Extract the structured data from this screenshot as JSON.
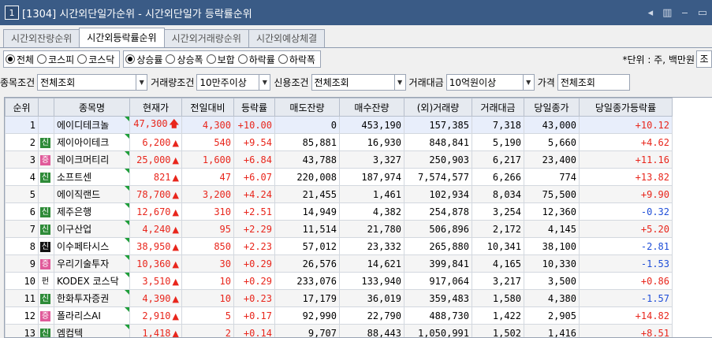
{
  "window": {
    "number": "1",
    "title": "[1304] 시간외단일가순위 - 시간외단일가 등락률순위",
    "controls": [
      "◂",
      "▥",
      "‒",
      "▭"
    ]
  },
  "tabs": [
    {
      "label": "시간외잔량순위",
      "active": false
    },
    {
      "label": "시간외등락률순위",
      "active": true
    },
    {
      "label": "시간외거래량순위",
      "active": false
    },
    {
      "label": "시간외예상체결",
      "active": false
    }
  ],
  "market_radios": [
    {
      "label": "전체",
      "selected": true
    },
    {
      "label": "코스피",
      "selected": false
    },
    {
      "label": "코스닥",
      "selected": false
    }
  ],
  "sort_radios": [
    {
      "label": "상승률",
      "selected": true
    },
    {
      "label": "상승폭",
      "selected": false
    },
    {
      "label": "보합",
      "selected": false
    },
    {
      "label": "하락률",
      "selected": false
    },
    {
      "label": "하락폭",
      "selected": false
    }
  ],
  "unit_text": "*단위 : 주, 백만원",
  "unit_button": "조",
  "filters": [
    {
      "label": "종목조건",
      "value": "전체조회"
    },
    {
      "label": "거래량조건",
      "value": "10만주이상"
    },
    {
      "label": "신용조건",
      "value": "전체조회"
    },
    {
      "label": "거래대금",
      "value": "10억원이상"
    },
    {
      "label": "가격",
      "value": "전체조회"
    }
  ],
  "columns": [
    "순위",
    "",
    "종목명",
    "현재가",
    "전일대비",
    "등락률",
    "매도잔량",
    "매수잔량",
    "(외)거래량",
    "거래대금",
    "당일종가",
    "당일종가등락률"
  ],
  "colors": {
    "up": "#e8261c",
    "down": "#1f4ed8",
    "title_bar": "#3a5b86",
    "badge_green": "#2e8b38",
    "badge_pink": "#e05a9a"
  },
  "rows": [
    {
      "rank": "1",
      "badge": "",
      "badge_color": "",
      "name": "에이디테크놀",
      "price": "47,300",
      "arrow": "up-bold",
      "change": "4,300",
      "rate": "+10.00",
      "ask": "0",
      "bid": "453,190",
      "volume": "157,385",
      "amount": "7,318",
      "close": "43,000",
      "close_rate": "+10.12",
      "close_dir": "up"
    },
    {
      "rank": "2",
      "badge": "신",
      "badge_color": "green",
      "name": "제이아이테크",
      "price": "6,200",
      "arrow": "up",
      "change": "540",
      "rate": "+9.54",
      "ask": "85,881",
      "bid": "16,930",
      "volume": "848,841",
      "amount": "5,190",
      "close": "5,660",
      "close_rate": "+4.62",
      "close_dir": "up"
    },
    {
      "rank": "3",
      "badge": "증",
      "badge_color": "pink",
      "name": "레이크머티리",
      "price": "25,000",
      "arrow": "up",
      "change": "1,600",
      "rate": "+6.84",
      "ask": "43,788",
      "bid": "3,327",
      "volume": "250,903",
      "amount": "6,217",
      "close": "23,400",
      "close_rate": "+11.16",
      "close_dir": "up"
    },
    {
      "rank": "4",
      "badge": "신",
      "badge_color": "green",
      "name": "소프트센",
      "price": "821",
      "arrow": "up",
      "change": "47",
      "rate": "+6.07",
      "ask": "220,008",
      "bid": "187,974",
      "volume": "7,574,577",
      "amount": "6,266",
      "close": "774",
      "close_rate": "+13.82",
      "close_dir": "up"
    },
    {
      "rank": "5",
      "badge": "",
      "badge_color": "",
      "name": "에이직랜드",
      "price": "78,700",
      "arrow": "up",
      "change": "3,200",
      "rate": "+4.24",
      "ask": "21,455",
      "bid": "1,461",
      "volume": "102,934",
      "amount": "8,034",
      "close": "75,500",
      "close_rate": "+9.90",
      "close_dir": "up"
    },
    {
      "rank": "6",
      "badge": "신",
      "badge_color": "green",
      "name": "제주은행",
      "price": "12,670",
      "arrow": "up",
      "change": "310",
      "rate": "+2.51",
      "ask": "14,949",
      "bid": "4,382",
      "volume": "254,878",
      "amount": "3,254",
      "close": "12,360",
      "close_rate": "-0.32",
      "close_dir": "down"
    },
    {
      "rank": "7",
      "badge": "신",
      "badge_color": "green",
      "name": "이구산업",
      "price": "4,240",
      "arrow": "up",
      "change": "95",
      "rate": "+2.29",
      "ask": "11,514",
      "bid": "21,780",
      "volume": "506,896",
      "amount": "2,172",
      "close": "4,145",
      "close_rate": "+5.20",
      "close_dir": "up"
    },
    {
      "rank": "8",
      "badge": "신",
      "badge_color": "black",
      "name": "이수페타시스",
      "price": "38,950",
      "arrow": "up",
      "change": "850",
      "rate": "+2.23",
      "ask": "57,012",
      "bid": "23,332",
      "volume": "265,880",
      "amount": "10,341",
      "close": "38,100",
      "close_rate": "-2.81",
      "close_dir": "down"
    },
    {
      "rank": "9",
      "badge": "증",
      "badge_color": "pink",
      "name": "우리기술투자",
      "price": "10,360",
      "arrow": "up",
      "change": "30",
      "rate": "+0.29",
      "ask": "26,576",
      "bid": "14,621",
      "volume": "399,841",
      "amount": "4,165",
      "close": "10,330",
      "close_rate": "-1.53",
      "close_dir": "down"
    },
    {
      "rank": "10",
      "badge": "펀",
      "badge_color": "plain",
      "name": "KODEX 코스닥",
      "price": "3,510",
      "arrow": "up",
      "change": "10",
      "rate": "+0.29",
      "ask": "233,076",
      "bid": "133,940",
      "volume": "917,064",
      "amount": "3,217",
      "close": "3,500",
      "close_rate": "+0.86",
      "close_dir": "up"
    },
    {
      "rank": "11",
      "badge": "신",
      "badge_color": "green",
      "name": "한화투자증권",
      "price": "4,390",
      "arrow": "up",
      "change": "10",
      "rate": "+0.23",
      "ask": "17,179",
      "bid": "36,019",
      "volume": "359,483",
      "amount": "1,580",
      "close": "4,380",
      "close_rate": "-1.57",
      "close_dir": "down"
    },
    {
      "rank": "12",
      "badge": "증",
      "badge_color": "pink",
      "name": "폴라리스AI",
      "price": "2,910",
      "arrow": "up",
      "change": "5",
      "rate": "+0.17",
      "ask": "92,990",
      "bid": "22,790",
      "volume": "488,730",
      "amount": "1,422",
      "close": "2,905",
      "close_rate": "+14.82",
      "close_dir": "up"
    },
    {
      "rank": "13",
      "badge": "신",
      "badge_color": "green",
      "name": "엠컴텍",
      "price": "1,418",
      "arrow": "up",
      "change": "2",
      "rate": "+0.14",
      "ask": "9,707",
      "bid": "88,443",
      "volume": "1,050,991",
      "amount": "1,502",
      "close": "1,416",
      "close_rate": "+8.51",
      "close_dir": "up"
    }
  ]
}
